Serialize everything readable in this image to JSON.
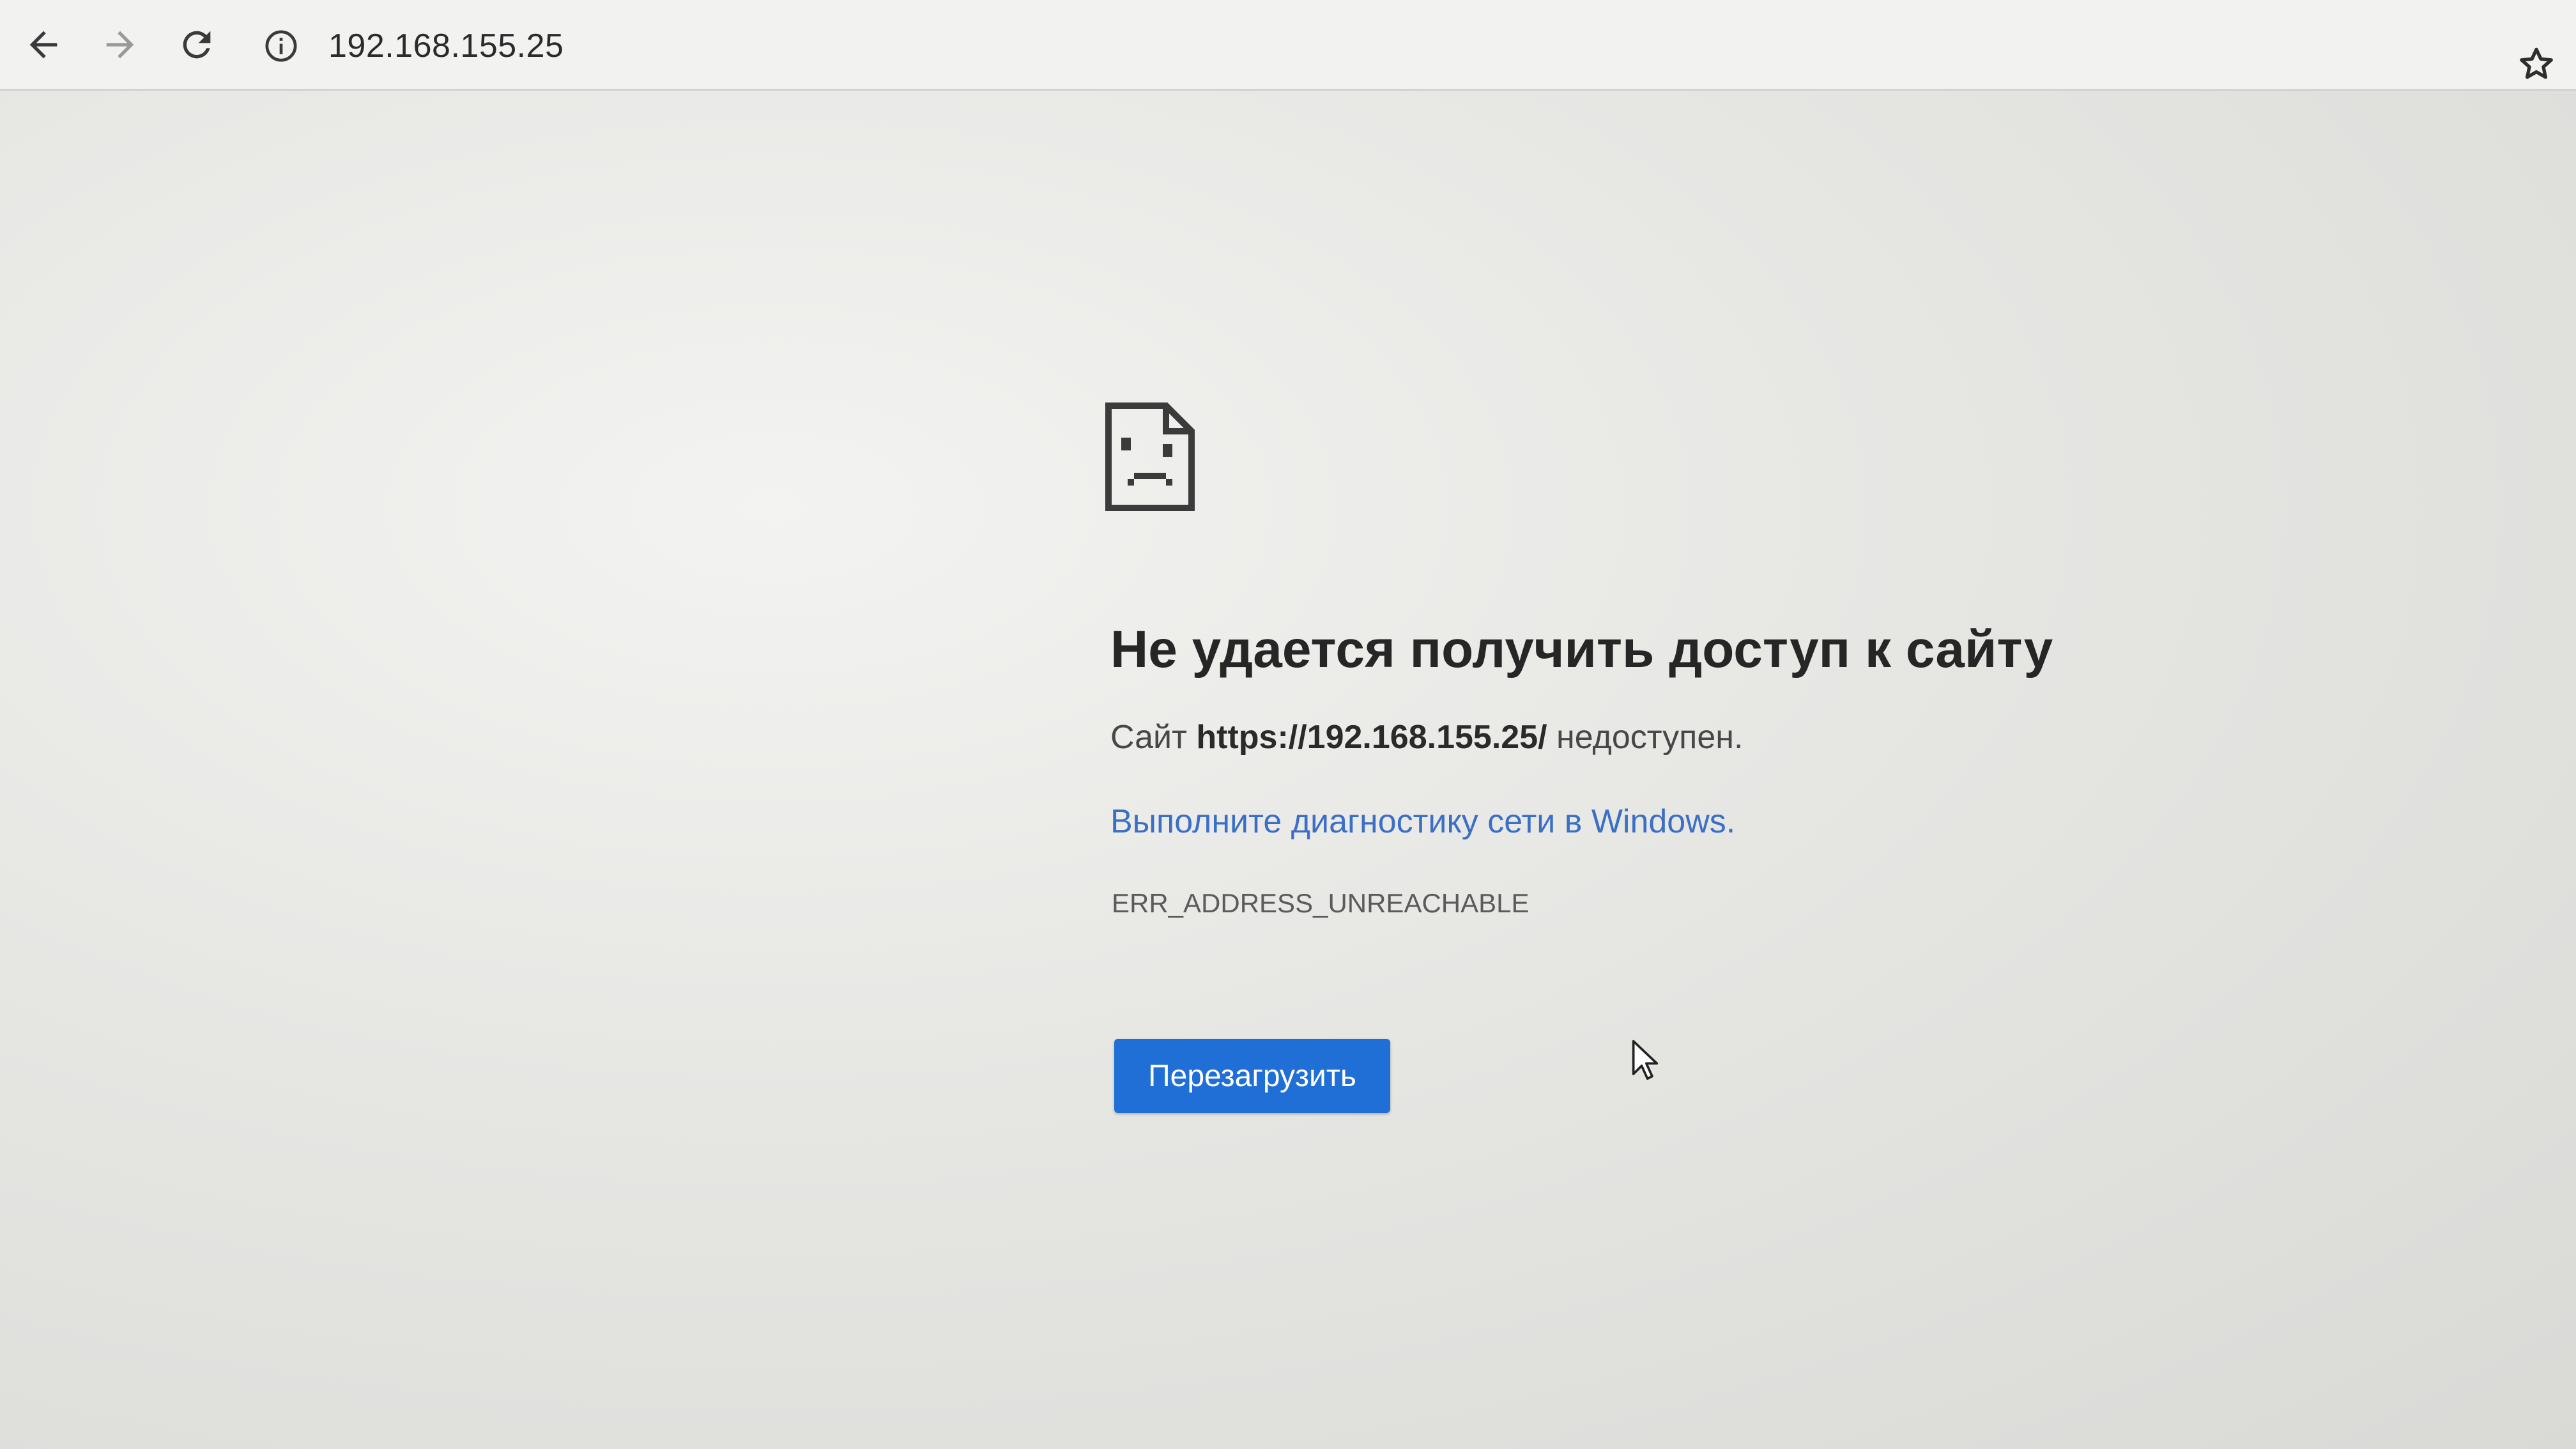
{
  "browser": {
    "address_bar": {
      "url": "192.168.155.25",
      "icons": {
        "back": "arrow-left-icon",
        "forward": "arrow-right-icon",
        "reload": "reload-icon",
        "info": "info-icon",
        "bookmark": "star-icon"
      }
    }
  },
  "error_page": {
    "icon": "sad-document-icon",
    "title": "Не удается получить доступ к сайту",
    "message_prefix": "Сайт ",
    "message_url": "https://192.168.155.25/",
    "message_suffix": " недоступен.",
    "diagnostics_link": "Выполните диагностику сети в Windows.",
    "error_code": "ERR_ADDRESS_UNREACHABLE",
    "reload_button": "Перезагрузить"
  },
  "colors": {
    "link": "#3b6fc6",
    "button": "#1f6fd6",
    "title": "#262626"
  }
}
